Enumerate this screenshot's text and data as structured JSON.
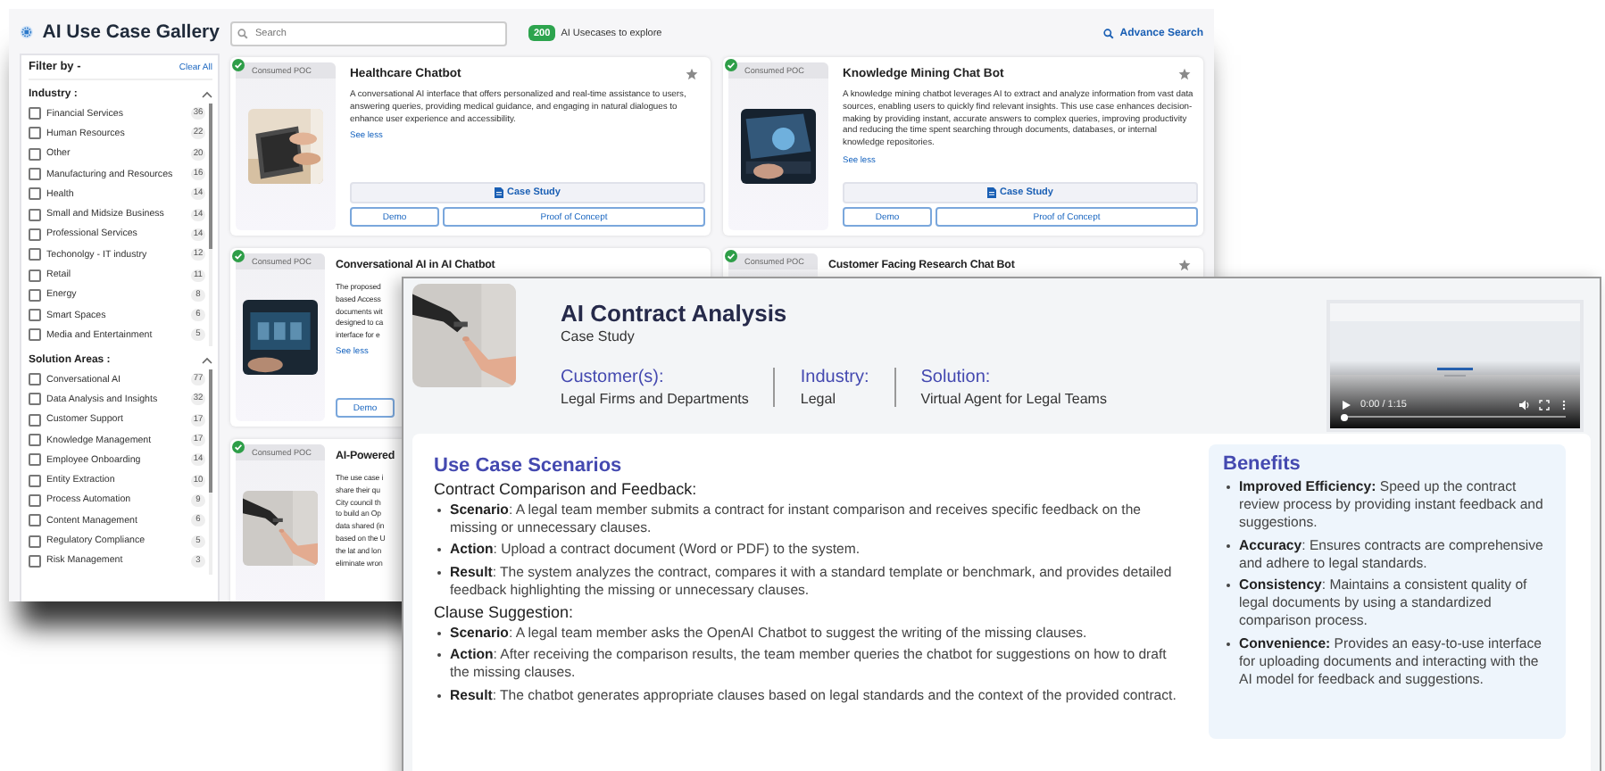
{
  "app": {
    "title": "AI Use Case Gallery"
  },
  "filters": {
    "heading": "Filter by -",
    "clear": "Clear All",
    "sections": [
      {
        "title": "Industry :",
        "expanded": true,
        "options": [
          {
            "label": "Financial Services",
            "count": "36",
            "checked": false
          },
          {
            "label": "Human Resources",
            "count": "22",
            "checked": false
          },
          {
            "label": "Other",
            "count": "20",
            "checked": false
          },
          {
            "label": "Manufacturing and Resources",
            "count": "16",
            "checked": false
          },
          {
            "label": "Health",
            "count": "14",
            "checked": false
          },
          {
            "label": "Small and Midsize Business",
            "count": "14",
            "checked": false
          },
          {
            "label": "Professional Services",
            "count": "14",
            "checked": false
          },
          {
            "label": "Techonolgy - IT industry",
            "count": "12",
            "checked": false
          },
          {
            "label": "Retail",
            "count": "11",
            "checked": false
          },
          {
            "label": "Energy",
            "count": "8",
            "checked": false
          },
          {
            "label": "Smart Spaces",
            "count": "6",
            "checked": false
          },
          {
            "label": "Media and Entertainment",
            "count": "5",
            "checked": false
          }
        ]
      },
      {
        "title": "Solution Areas :",
        "expanded": true,
        "options": [
          {
            "label": "Conversational AI",
            "count": "77",
            "checked": false
          },
          {
            "label": "Data Analysis and Insights",
            "count": "32",
            "checked": false
          },
          {
            "label": "Customer Support",
            "count": "17",
            "checked": false
          },
          {
            "label": "Knowledge Management",
            "count": "17",
            "checked": false
          },
          {
            "label": "Employee Onboarding",
            "count": "14",
            "checked": false
          },
          {
            "label": "Entity Extraction",
            "count": "10",
            "checked": false
          },
          {
            "label": "Process Automation",
            "count": "9",
            "checked": false
          },
          {
            "label": "Content Management",
            "count": "6",
            "checked": false
          },
          {
            "label": "Regulatory Compliance",
            "count": "5",
            "checked": false
          },
          {
            "label": "Risk Management",
            "count": "3",
            "checked": false
          }
        ]
      }
    ]
  },
  "search": {
    "placeholder": "Search"
  },
  "summary": {
    "count": "200",
    "text": "AI Usecases to explore"
  },
  "advanced_search": "Advance Search",
  "cards": [
    {
      "status": "Consumed POC",
      "title": "Healthcare Chatbot",
      "starred": false,
      "description": "A conversational AI interface that offers personalized and real-time assistance to users, answering queries, providing medical guidance, and engaging in natural dialogues to enhance user experience and accessibility.",
      "link": "See less",
      "case_study": "Case Study",
      "buttons": [
        "Demo",
        "Proof of Concept"
      ]
    },
    {
      "status": "Consumed POC",
      "title": "Knowledge Mining Chat Bot",
      "starred": false,
      "description": "A knowledge mining chatbot leverages AI to extract and analyze information from vast data sources, enabling users to quickly find relevant insights. This use case enhances decision-making by providing instant, accurate answers to complex queries, improving productivity and reducing the time spent searching through documents, databases, or internal knowledge repositories.",
      "link": "See less",
      "case_study": "Case Study",
      "buttons": [
        "Demo",
        "Proof of Concept"
      ]
    },
    {
      "status": "Consumed POC",
      "title": "Conversational AI in AI Chatbot",
      "description_lines": [
        "The proposed",
        "based Access",
        "documents wit",
        "designed to ca",
        "interface for e"
      ],
      "link": "See less",
      "buttons": [
        "Demo"
      ]
    },
    {
      "status": "Consumed POC",
      "title": "Customer Facing Research Chat Bot",
      "starred": false
    },
    {
      "status": "Consumed POC",
      "title": "AI-Powered",
      "description_lines": [
        "The use case i",
        "share their qu",
        "City council th",
        "to build an Op",
        "data shared (in",
        "based on the U",
        "the lat and lon",
        "eliminate wron"
      ]
    }
  ],
  "detail": {
    "title": "AI Contract Analysis",
    "subtitle": "Case Study",
    "meta": [
      {
        "label": "Customer(s):",
        "value": "Legal Firms and Departments"
      },
      {
        "label": "Industry:",
        "value": "Legal"
      },
      {
        "label": "Solution:",
        "value": "Virtual Agent for Legal Teams"
      }
    ],
    "video": {
      "time": "0:00 / 1:15",
      "level": 0
    },
    "scenarios": {
      "heading": "Use Case Scenarios",
      "groups": [
        {
          "title": "Contract Comparison and Feedback:",
          "bullets": [
            "**Scenario**: A legal team member submits a contract for instant comparison and receives specific feedback on the missing or unnecessary clauses.",
            "**Action**: Upload a contract document (Word or PDF) to the system.",
            "**Result**: The system analyzes the contract, compares it with a standard template or benchmark, and provides detailed feedback highlighting the missing or unnecessary clauses."
          ]
        },
        {
          "title": "Clause Suggestion:",
          "bullets": [
            "**Scenario**: A legal team member asks the OpenAI Chatbot to suggest the writing of the missing clauses.",
            "**Action**: After receiving the comparison results, the team member queries the chatbot for suggestions on how to draft the missing clauses.",
            "**Result**: The chatbot generates appropriate clauses based on legal standards and the context of the provided contract."
          ]
        }
      ]
    },
    "benefits": {
      "heading": "Benefits",
      "items": [
        "**Improved Efficiency:** Speed up the contract review process by providing instant feedback and suggestions.",
        "**Accuracy**: Ensures contracts are comprehensive and adhere to legal standards.",
        "**Consistency**: Maintains a consistent quality of legal documents by using a standardized comparison process.",
        "**Convenience:** Provides an easy-to-use interface for uploading documents and interacting with the AI model for feedback and suggestions."
      ]
    }
  }
}
